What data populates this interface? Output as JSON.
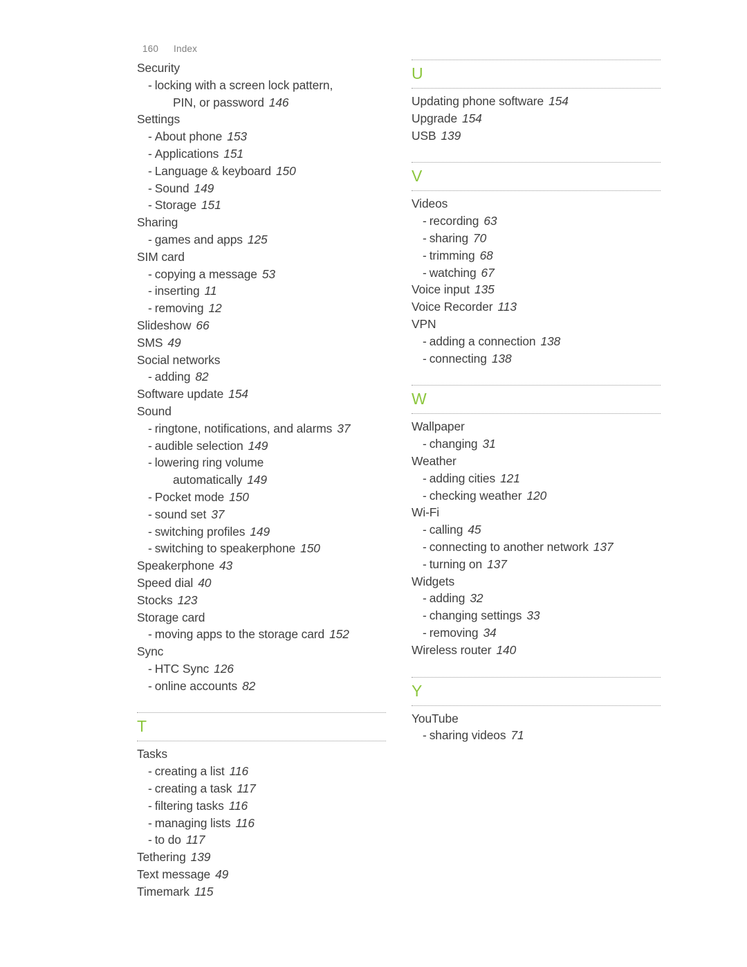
{
  "header": {
    "page_number": "160",
    "title": "Index"
  },
  "colors": {
    "section_letter": "#8cc63e",
    "text": "#3f3f3f",
    "header_text": "#808080",
    "rule": "#9a9a9a"
  },
  "columns": [
    {
      "name": "left-column",
      "sections": [
        {
          "letter": null,
          "entries": [
            {
              "level": "main",
              "text": "Security",
              "page": ""
            },
            {
              "level": "sub",
              "text": "locking with a screen lock pattern,",
              "page": ""
            },
            {
              "level": "cont",
              "text": "PIN, or password",
              "page": "146"
            },
            {
              "level": "main",
              "text": "Settings",
              "page": ""
            },
            {
              "level": "sub",
              "text": "About phone",
              "page": "153"
            },
            {
              "level": "sub",
              "text": "Applications",
              "page": "151"
            },
            {
              "level": "sub",
              "text": "Language & keyboard",
              "page": "150"
            },
            {
              "level": "sub",
              "text": "Sound",
              "page": "149"
            },
            {
              "level": "sub",
              "text": "Storage",
              "page": "151"
            },
            {
              "level": "main",
              "text": "Sharing",
              "page": ""
            },
            {
              "level": "sub",
              "text": "games and apps",
              "page": "125"
            },
            {
              "level": "main",
              "text": "SIM card",
              "page": ""
            },
            {
              "level": "sub",
              "text": "copying a message",
              "page": "53"
            },
            {
              "level": "sub",
              "text": "inserting",
              "page": "11"
            },
            {
              "level": "sub",
              "text": "removing",
              "page": "12"
            },
            {
              "level": "main",
              "text": "Slideshow",
              "page": "66"
            },
            {
              "level": "main",
              "text": "SMS",
              "page": "49"
            },
            {
              "level": "main",
              "text": "Social networks",
              "page": ""
            },
            {
              "level": "sub",
              "text": "adding",
              "page": "82"
            },
            {
              "level": "main",
              "text": "Software update",
              "page": "154"
            },
            {
              "level": "main",
              "text": "Sound",
              "page": ""
            },
            {
              "level": "sub",
              "text": "ringtone, notifications, and alarms",
              "page": "37"
            },
            {
              "level": "sub",
              "text": "audible selection",
              "page": "149"
            },
            {
              "level": "sub",
              "text": "lowering ring volume",
              "page": ""
            },
            {
              "level": "cont",
              "text": "automatically",
              "page": "149"
            },
            {
              "level": "sub",
              "text": "Pocket mode",
              "page": "150"
            },
            {
              "level": "sub",
              "text": "sound set",
              "page": "37"
            },
            {
              "level": "sub",
              "text": "switching profiles",
              "page": "149"
            },
            {
              "level": "sub",
              "text": "switching to speakerphone",
              "page": "150"
            },
            {
              "level": "main",
              "text": "Speakerphone",
              "page": "43"
            },
            {
              "level": "main",
              "text": "Speed dial",
              "page": "40"
            },
            {
              "level": "main",
              "text": "Stocks",
              "page": "123"
            },
            {
              "level": "main",
              "text": "Storage card",
              "page": ""
            },
            {
              "level": "sub",
              "text": "moving apps to the storage card",
              "page": "152"
            },
            {
              "level": "main",
              "text": "Sync",
              "page": ""
            },
            {
              "level": "sub",
              "text": "HTC Sync",
              "page": "126"
            },
            {
              "level": "sub",
              "text": "online accounts",
              "page": "82"
            }
          ]
        },
        {
          "letter": "T",
          "entries": [
            {
              "level": "main",
              "text": "Tasks",
              "page": ""
            },
            {
              "level": "sub",
              "text": "creating a list",
              "page": "116"
            },
            {
              "level": "sub",
              "text": "creating a task",
              "page": "117"
            },
            {
              "level": "sub",
              "text": "filtering tasks",
              "page": "116"
            },
            {
              "level": "sub",
              "text": "managing lists",
              "page": "116"
            },
            {
              "level": "sub",
              "text": "to do",
              "page": "117"
            },
            {
              "level": "main",
              "text": "Tethering",
              "page": "139"
            },
            {
              "level": "main",
              "text": "Text message",
              "page": "49"
            },
            {
              "level": "main",
              "text": "Timemark",
              "page": "115"
            }
          ]
        }
      ]
    },
    {
      "name": "right-column",
      "sections": [
        {
          "letter": "U",
          "entries": [
            {
              "level": "main",
              "text": "Updating phone software",
              "page": "154"
            },
            {
              "level": "main",
              "text": "Upgrade",
              "page": "154"
            },
            {
              "level": "main",
              "text": "USB",
              "page": "139"
            }
          ]
        },
        {
          "letter": "V",
          "entries": [
            {
              "level": "main",
              "text": "Videos",
              "page": ""
            },
            {
              "level": "sub",
              "text": "recording",
              "page": "63"
            },
            {
              "level": "sub",
              "text": "sharing",
              "page": "70"
            },
            {
              "level": "sub",
              "text": "trimming",
              "page": "68"
            },
            {
              "level": "sub",
              "text": "watching",
              "page": "67"
            },
            {
              "level": "main",
              "text": "Voice input",
              "page": "135"
            },
            {
              "level": "main",
              "text": "Voice Recorder",
              "page": "113"
            },
            {
              "level": "main",
              "text": "VPN",
              "page": ""
            },
            {
              "level": "sub",
              "text": "adding a connection",
              "page": "138"
            },
            {
              "level": "sub",
              "text": "connecting",
              "page": "138"
            }
          ]
        },
        {
          "letter": "W",
          "entries": [
            {
              "level": "main",
              "text": "Wallpaper",
              "page": ""
            },
            {
              "level": "sub",
              "text": "changing",
              "page": "31"
            },
            {
              "level": "main",
              "text": "Weather",
              "page": ""
            },
            {
              "level": "sub",
              "text": "adding cities",
              "page": "121"
            },
            {
              "level": "sub",
              "text": "checking weather",
              "page": "120"
            },
            {
              "level": "main",
              "text": "Wi-Fi",
              "page": ""
            },
            {
              "level": "sub",
              "text": "calling",
              "page": "45"
            },
            {
              "level": "sub",
              "text": "connecting to another network",
              "page": "137"
            },
            {
              "level": "sub",
              "text": "turning on",
              "page": "137"
            },
            {
              "level": "main",
              "text": "Widgets",
              "page": ""
            },
            {
              "level": "sub",
              "text": "adding",
              "page": "32"
            },
            {
              "level": "sub",
              "text": "changing settings",
              "page": "33"
            },
            {
              "level": "sub",
              "text": "removing",
              "page": "34"
            },
            {
              "level": "main",
              "text": "Wireless router",
              "page": "140"
            }
          ]
        },
        {
          "letter": "Y",
          "entries": [
            {
              "level": "main",
              "text": "YouTube",
              "page": ""
            },
            {
              "level": "sub",
              "text": "sharing videos",
              "page": "71"
            }
          ]
        }
      ]
    }
  ]
}
